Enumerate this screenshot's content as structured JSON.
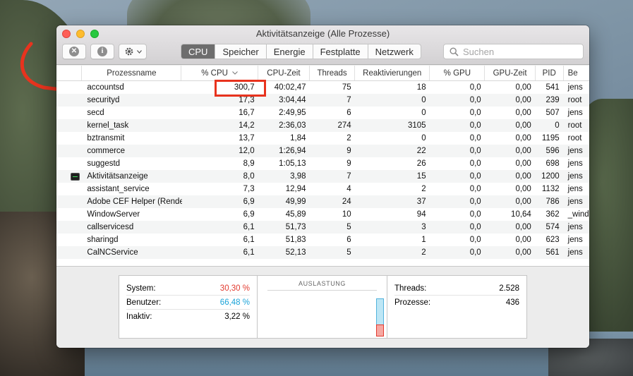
{
  "window": {
    "title": "Aktivitätsanzeige (Alle Prozesse)"
  },
  "toolbar": {
    "close_icon": "x-circle-icon",
    "info_icon": "info-icon",
    "gear_icon": "gear-icon",
    "tabs": [
      {
        "label": "CPU",
        "active": true
      },
      {
        "label": "Speicher",
        "active": false
      },
      {
        "label": "Energie",
        "active": false
      },
      {
        "label": "Festplatte",
        "active": false
      },
      {
        "label": "Netzwerk",
        "active": false
      }
    ],
    "search_placeholder": "Suchen"
  },
  "table": {
    "columns": [
      "Prozessname",
      "% CPU",
      "CPU-Zeit",
      "Threads",
      "Reaktivierungen",
      "% GPU",
      "GPU-Zeit",
      "PID",
      "Be"
    ],
    "rows": [
      {
        "name": "accountsd",
        "cpu": "300,7",
        "time": "40:02,47",
        "threads": "75",
        "wake": "18",
        "gpu": "0,0",
        "gtime": "0,00",
        "pid": "541",
        "user": "jens",
        "icon": false
      },
      {
        "name": "securityd",
        "cpu": "17,3",
        "time": "3:04,44",
        "threads": "7",
        "wake": "0",
        "gpu": "0,0",
        "gtime": "0,00",
        "pid": "239",
        "user": "root",
        "icon": false
      },
      {
        "name": "secd",
        "cpu": "16,7",
        "time": "2:49,95",
        "threads": "6",
        "wake": "0",
        "gpu": "0,0",
        "gtime": "0,00",
        "pid": "507",
        "user": "jens",
        "icon": false
      },
      {
        "name": "kernel_task",
        "cpu": "14,2",
        "time": "2:36,03",
        "threads": "274",
        "wake": "3105",
        "gpu": "0,0",
        "gtime": "0,00",
        "pid": "0",
        "user": "root",
        "icon": false
      },
      {
        "name": "bztransmit",
        "cpu": "13,7",
        "time": "1,84",
        "threads": "2",
        "wake": "0",
        "gpu": "0,0",
        "gtime": "0,00",
        "pid": "1195",
        "user": "root",
        "icon": false
      },
      {
        "name": "commerce",
        "cpu": "12,0",
        "time": "1:26,94",
        "threads": "9",
        "wake": "22",
        "gpu": "0,0",
        "gtime": "0,00",
        "pid": "596",
        "user": "jens",
        "icon": false
      },
      {
        "name": "suggestd",
        "cpu": "8,9",
        "time": "1:05,13",
        "threads": "9",
        "wake": "26",
        "gpu": "0,0",
        "gtime": "0,00",
        "pid": "698",
        "user": "jens",
        "icon": false
      },
      {
        "name": "Aktivitätsanzeige",
        "cpu": "8,0",
        "time": "3,98",
        "threads": "7",
        "wake": "15",
        "gpu": "0,0",
        "gtime": "0,00",
        "pid": "1200",
        "user": "jens",
        "icon": true
      },
      {
        "name": "assistant_service",
        "cpu": "7,3",
        "time": "12,94",
        "threads": "4",
        "wake": "2",
        "gpu": "0,0",
        "gtime": "0,00",
        "pid": "1132",
        "user": "jens",
        "icon": false
      },
      {
        "name": "Adobe CEF Helper (Render...",
        "cpu": "6,9",
        "time": "49,99",
        "threads": "24",
        "wake": "37",
        "gpu": "0,0",
        "gtime": "0,00",
        "pid": "786",
        "user": "jens",
        "icon": false
      },
      {
        "name": "WindowServer",
        "cpu": "6,9",
        "time": "45,89",
        "threads": "10",
        "wake": "94",
        "gpu": "0,0",
        "gtime": "10,64",
        "pid": "362",
        "user": "_wind",
        "icon": false
      },
      {
        "name": "callservicesd",
        "cpu": "6,1",
        "time": "51,73",
        "threads": "5",
        "wake": "3",
        "gpu": "0,0",
        "gtime": "0,00",
        "pid": "574",
        "user": "jens",
        "icon": false
      },
      {
        "name": "sharingd",
        "cpu": "6,1",
        "time": "51,83",
        "threads": "6",
        "wake": "1",
        "gpu": "0,0",
        "gtime": "0,00",
        "pid": "623",
        "user": "jens",
        "icon": false
      },
      {
        "name": "CalNCService",
        "cpu": "6,1",
        "time": "52,13",
        "threads": "5",
        "wake": "2",
        "gpu": "0,0",
        "gtime": "0,00",
        "pid": "561",
        "user": "jens",
        "icon": false
      }
    ]
  },
  "summary": {
    "system_label": "System:",
    "system_value": "30,30 %",
    "user_label": "Benutzer:",
    "user_value": "66,48 %",
    "idle_label": "Inaktiv:",
    "idle_value": "3,22 %",
    "load_title": "AUSLASTUNG",
    "threads_label": "Threads:",
    "threads_value": "2.528",
    "processes_label": "Prozesse:",
    "processes_value": "436",
    "load_total_fraction": 0.97,
    "load_system_fraction": 0.3
  },
  "colors": {
    "system": "#e23a2f",
    "user": "#1aa3d8",
    "highlight": "#e8331e"
  }
}
